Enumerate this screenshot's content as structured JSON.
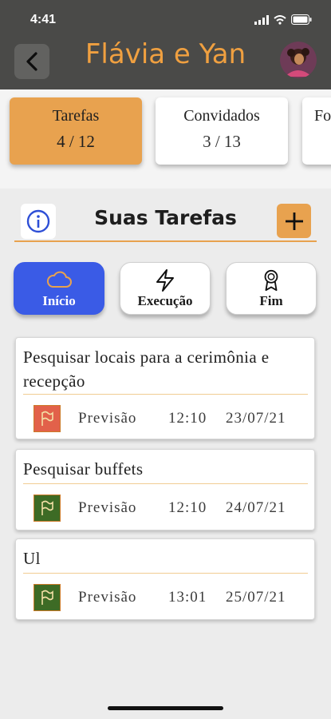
{
  "status_bar": {
    "time": "4:41"
  },
  "header": {
    "title": "Flávia e Yan"
  },
  "stats": [
    {
      "label": "Tarefas",
      "value": "4 / 12",
      "active": true
    },
    {
      "label": "Convidados",
      "value": "3 / 13",
      "active": false
    },
    {
      "label": "Fo",
      "value": "",
      "active": false
    }
  ],
  "section": {
    "title": "Suas Tarefas"
  },
  "phases": [
    {
      "label": "Início",
      "icon": "cloud-icon",
      "active": true
    },
    {
      "label": "Execução",
      "icon": "lightning-icon",
      "active": false
    },
    {
      "label": "Fim",
      "icon": "ribbon-award-icon",
      "active": false
    }
  ],
  "tasks": [
    {
      "title": "Pesquisar locais para a cerimônia e recepção",
      "prevision_label": "Previsão",
      "time": "12:10",
      "date": "23/07/21",
      "flag_color": "#e2614a"
    },
    {
      "title": "Pesquisar buffets",
      "prevision_label": "Previsão",
      "time": "12:10",
      "date": "24/07/21",
      "flag_color": "#3d6b25"
    },
    {
      "title": "Ul",
      "prevision_label": "Previsão",
      "time": "13:01",
      "date": "25/07/21",
      "flag_color": "#3d6b25"
    }
  ],
  "colors": {
    "accent": "#e8a24f",
    "header_bg": "#4a4a48",
    "title": "#f0a040",
    "active_phase": "#3a5be6"
  }
}
